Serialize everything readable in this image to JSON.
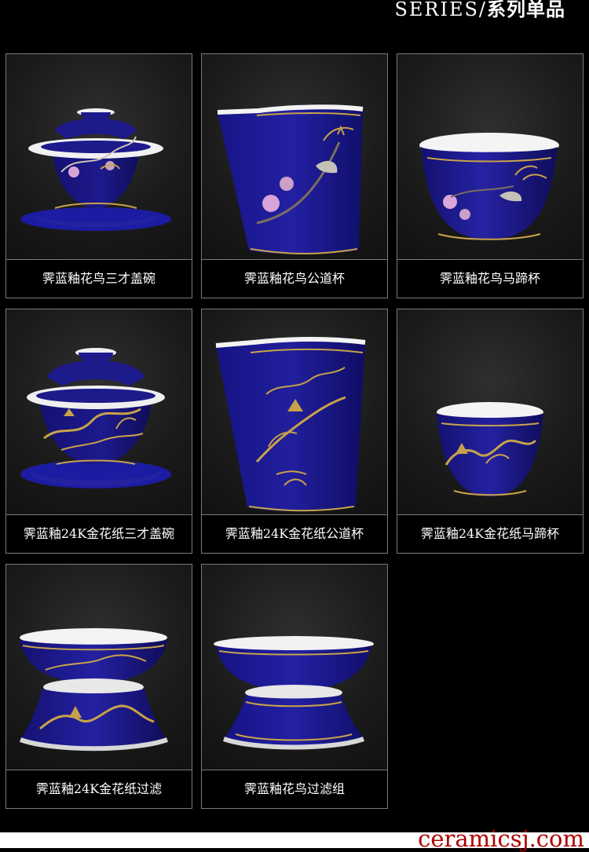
{
  "header": {
    "prefix": "SERIES/",
    "title": "系列单品"
  },
  "products": [
    {
      "name": "霁蓝釉花鸟三才盖碗",
      "icon": "lidded-bowl-icon",
      "style": "bird"
    },
    {
      "name": "霁蓝釉花鸟公道杯",
      "icon": "fair-cup-icon",
      "style": "bird"
    },
    {
      "name": "霁蓝釉花鸟马蹄杯",
      "icon": "horseshoe-cup-icon",
      "style": "bird"
    },
    {
      "name": "霁蓝釉24K金花纸三才盖碗",
      "icon": "lidded-bowl-icon",
      "style": "gold"
    },
    {
      "name": "霁蓝釉24K金花纸公道杯",
      "icon": "fair-cup-icon",
      "style": "gold"
    },
    {
      "name": "霁蓝釉24K金花纸马蹄杯",
      "icon": "horseshoe-cup-icon",
      "style": "gold"
    },
    {
      "name": "霁蓝釉24K金花纸过滤",
      "icon": "tea-strainer-icon",
      "style": "gold"
    },
    {
      "name": "霁蓝釉花鸟过滤组",
      "icon": "tea-strainer-icon",
      "style": "plain"
    }
  ],
  "watermark": "ceramicsj.com",
  "colors": {
    "background": "#000000",
    "cobalt": "#1d1a8c",
    "gold": "#c8a24a",
    "border": "#7a7a7a",
    "watermark": "#b00000"
  }
}
